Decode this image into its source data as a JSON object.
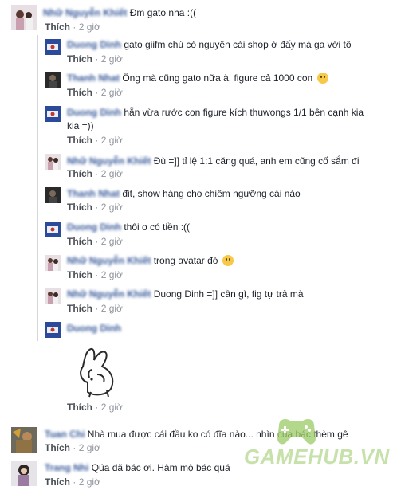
{
  "comments": [
    {
      "name": "Nhữ Nguyễn Khiết",
      "text": "Đm gato nha :((",
      "like": "Thích",
      "time": "2 giờ"
    },
    {
      "name": "Duong Dinh",
      "text": "gato giifm chú có nguyên cái shop ở đấy mà ga với tô",
      "like": "Thích",
      "time": "2 giờ"
    },
    {
      "name": "Thanh Nhat",
      "text": "Ông mà cũng gato nữa à, figure cả 1000 con",
      "like": "Thích",
      "time": "2 giờ"
    },
    {
      "name": "Duong Dinh",
      "text_line1": "hẵn vừa rước con figure kích thuwongs 1/1 bên cạnh kia",
      "text_line2": "kia =))",
      "like": "Thích",
      "time": "2 giờ"
    },
    {
      "name": "Nhữ Nguyễn Khiết",
      "text": "Đù =]] tỉ lệ 1:1 căng quá, anh em cũng cố sắm đi",
      "like": "Thích",
      "time": "2 giờ"
    },
    {
      "name": "Thanh Nhat",
      "text": "địt, show hàng cho chiêm ngưỡng cái nào",
      "like": "Thích",
      "time": "2 giờ"
    },
    {
      "name": "Duong Dinh",
      "text": "thôi o có tiền :((",
      "like": "Thích",
      "time": "2 giờ"
    },
    {
      "name": "Nhữ Nguyễn Khiết",
      "text": "trong avatar đó",
      "like": "Thích",
      "time": "2 giờ"
    },
    {
      "name": "Nhữ Nguyễn Khiết",
      "text": "Duong Dinh =]] cần gì, fig tự trả mà",
      "like": "Thích",
      "time": "2 giờ"
    },
    {
      "name": "Duong Dinh",
      "like": "Thích",
      "time": "2 giờ"
    },
    {
      "name": "Tuan Chi",
      "text": "Nhà mua được cái đầu ko có đĩa nào... nhìn của bác thèm gê",
      "like": "Thích",
      "time": "2 giờ"
    },
    {
      "name": "Trang Nhi",
      "text": "Qúa đã bác ơi. Hâm mộ bác quá",
      "like": "Thích",
      "time": "2 giờ"
    }
  ],
  "separator": "·",
  "watermark": "GAMEHUB.VN",
  "colors": {
    "link": "#365899",
    "meta": "#90949c",
    "accent_green": "#9ccc65"
  }
}
